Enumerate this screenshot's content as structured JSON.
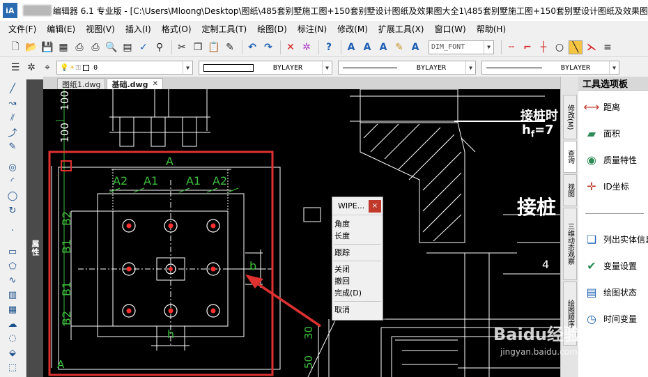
{
  "window": {
    "title": "编辑器 6.1 专业版 - [C:\\Users\\Mloong\\Desktop\\图纸\\485套别墅施工图+150套别墅设计图纸及效果图大全1\\485套别墅施工图+150套别墅设计图纸及效果图",
    "logo": "iA"
  },
  "menu": {
    "items": [
      "文件(F)",
      "编辑(E)",
      "视图(V)",
      "插入(I)",
      "格式(O)",
      "定制工具(T)",
      "绘图(D)",
      "标注(N)",
      "修改(M)",
      "扩展工具(X)",
      "窗口(W)",
      "帮助(H)"
    ]
  },
  "toolbar": {
    "text_style": "DIM_FONT",
    "icons": [
      "new-icon",
      "open-icon",
      "save-icon",
      "saveas-icon",
      "print-icon",
      "plot-icon",
      "preview-icon",
      "publish-icon",
      "spell-icon",
      "find-icon",
      "cut-icon",
      "copy-icon",
      "paste-icon",
      "matchprop-icon",
      "undo-icon",
      "redo-icon",
      "delete-icon",
      "xref-icon",
      "help-icon"
    ]
  },
  "layerbar": {
    "layer_value": "0",
    "linetype": "BYLAYER",
    "lineweight": "BYLAYER",
    "color": "BYLAYER"
  },
  "doctabs": {
    "tabs": [
      {
        "label": "图纸1.dwg",
        "active": false
      },
      {
        "label": "基础.dwg",
        "active": true
      }
    ],
    "close": "✕"
  },
  "left_panel": {
    "properties_tab": "属性"
  },
  "drawing": {
    "text": {
      "A_top": "A",
      "A2_left": "A2",
      "A1_left": "A1",
      "A1_right": "A1",
      "A2_right": "A2",
      "B2_top": "B2",
      "B1_top": "B1",
      "B1_bottom": "B1",
      "B2_bottom": "B2",
      "b_label": "b",
      "h_label": "h",
      "A_bottom": "A",
      "dim_100_a": "100",
      "dim_100_b": "100",
      "dim_30": "30",
      "dim_50": "50",
      "dim_4": "4",
      "pile_top": "接桩时",
      "hf_base": "h",
      "hf_sub": "f",
      "hf_eq": "=7",
      "pile_bottom": "接桩"
    }
  },
  "context_menu": {
    "title": "WIPE...",
    "close": "×",
    "items": [
      "角度",
      "长度",
      "跟踪",
      "关闭",
      "撤回",
      "完成(D)",
      "取消"
    ]
  },
  "palette": {
    "title": "工具选项板",
    "vtabs": [
      "修改(M)",
      "查询",
      "视图",
      "三维动态观察",
      "绘图顺序"
    ],
    "items": [
      {
        "label": "距离",
        "icon": "distance-icon"
      },
      {
        "label": "面积",
        "icon": "area-icon"
      },
      {
        "label": "质量特性",
        "icon": "massprop-icon"
      },
      {
        "label": "ID坐标",
        "icon": "id-point-icon"
      },
      {
        "label": "列出实体信息",
        "icon": "list-icon"
      },
      {
        "label": "变量设置",
        "icon": "setvar-icon"
      },
      {
        "label": "绘图状态",
        "icon": "status-icon"
      },
      {
        "label": "时间变量",
        "icon": "time-icon"
      }
    ]
  },
  "watermark": {
    "text": "Baidu经验",
    "sub": "jingyan.baidu.com"
  },
  "colors": {
    "canvas": "#000000",
    "highlight_red": "#e03131",
    "dim_green": "#3cbf3c",
    "bolt_red": "#ff3030"
  }
}
